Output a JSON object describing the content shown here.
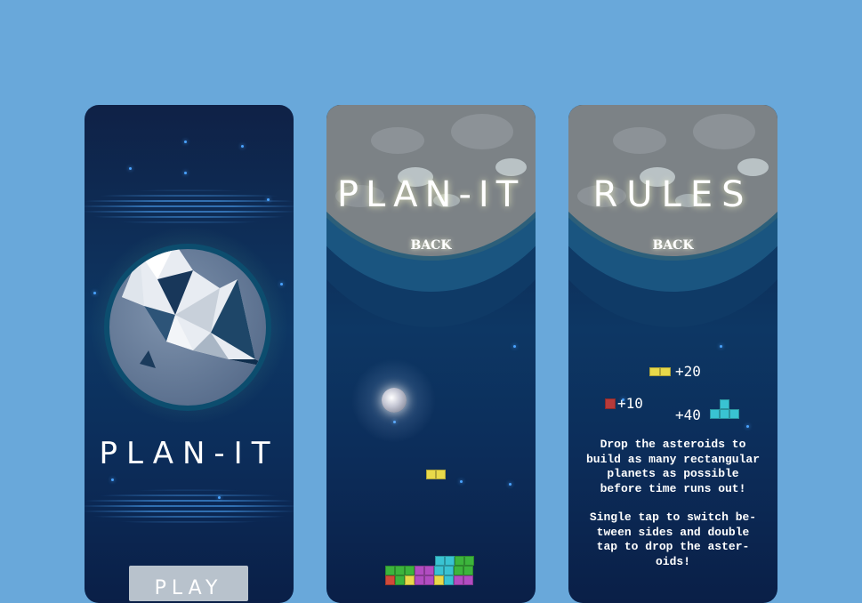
{
  "screen_home": {
    "title": "PLAN-IT",
    "play_label": "PLAY"
  },
  "screen_game": {
    "title": "PLAN-IT",
    "back_label": "BACK"
  },
  "screen_rules": {
    "title": "RULES",
    "back_label": "BACK",
    "scores": [
      {
        "value": "+20",
        "color": "#e8d94a"
      },
      {
        "value": "+10",
        "color": "#b83a3a"
      },
      {
        "value": "+40",
        "color": "#39c3d2"
      }
    ],
    "paragraph1": "Drop the asteroids to\nbuild as many rectangular\nplanets as possible\nbefore time runs out!",
    "paragraph2": "Single tap to switch be-\ntween sides and double\ntap to drop the aster-\noids!"
  },
  "colors": {
    "background": "#69a8da",
    "screen_dark": "#0d2a57",
    "moon_gray": "#7c8286",
    "glow_blue": "#4aa3ff"
  }
}
